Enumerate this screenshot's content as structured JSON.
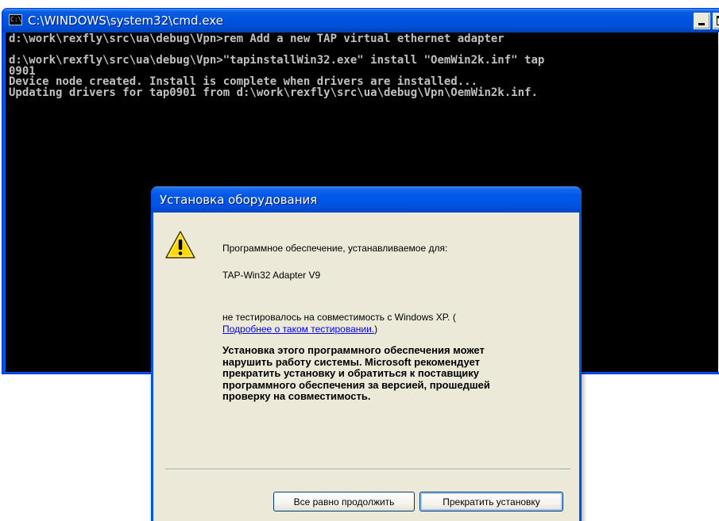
{
  "cmd_window": {
    "title": "C:\\WINDOWS\\system32\\cmd.exe",
    "icon": "console-icon",
    "icon_label": "C:\\",
    "console_lines": [
      "d:\\work\\rexfly\\src\\ua\\debug\\Vpn>rem Add a new TAP virtual ethernet adapter",
      "",
      "d:\\work\\rexfly\\src\\ua\\debug\\Vpn>\"tapinstallWin32.exe\" install \"OemWin2k.inf\" tap",
      "0901",
      "Device node created. Install is complete when drivers are installed...",
      "Updating drivers for tap0901 from d:\\work\\rexfly\\src\\ua\\debug\\Vpn\\OemWin2k.inf."
    ]
  },
  "dialog": {
    "title": "Установка оборудования",
    "icon": "warning-icon",
    "intro": "Программное обеспечение, устанавливаемое для:",
    "device_name": "TAP-Win32 Adapter V9",
    "compat_text": "не тестировалось на совместимость с Windows XP. (",
    "details_link": "Подробнее о таком тестировании.",
    "compat_close": ")",
    "warning_lines": [
      "Установка этого программного обеспечения может",
      "нарушить работу системы. Microsoft рекомендует",
      "прекратить установку и обратиться к поставщику",
      "программного обеспечения за версией, прошедшей",
      "проверку на совместимость."
    ],
    "continue_button": "Все равно продолжить",
    "stop_button": "Прекратить установку"
  },
  "colors": {
    "xp_title_blue": "#0054e3",
    "console_bg": "#000000",
    "console_text": "#c0c0c0",
    "dialog_face": "#ece9d8",
    "link": "#0000ee",
    "warning_yellow": "#ffd800"
  }
}
